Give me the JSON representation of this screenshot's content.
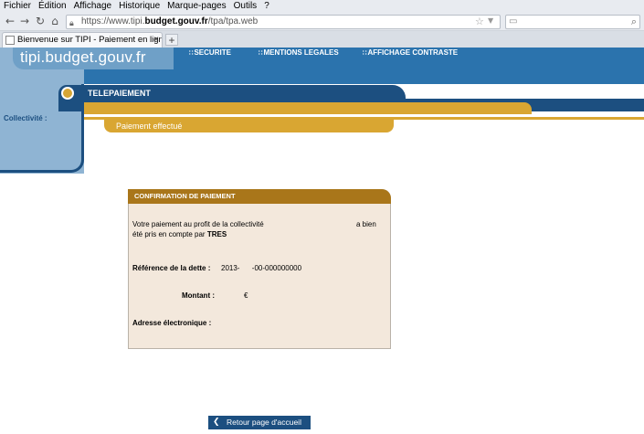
{
  "browser": {
    "menu": [
      "Fichier",
      "Édition",
      "Affichage",
      "Historique",
      "Marque-pages",
      "Outils",
      "?"
    ],
    "url_prefix": "https://www.tipi.",
    "url_domain": "budget.gouv.fr",
    "url_path": "/tpa/tpa.web",
    "tab_title": "Bienvenue sur TIPI - Paiement en ligne d...",
    "tab_close": "×",
    "new_tab": "+"
  },
  "site": {
    "logo": "tipi.budget.gouv.fr",
    "links": [
      "SECURITE",
      "MENTIONS LEGALES",
      "AFFICHAGE CONTRASTE"
    ],
    "collectivite_label": "Collectivité :",
    "section_title": "TELEPAIEMENT",
    "status_tab": "Paiement effectué"
  },
  "confirmation": {
    "title": "CONFIRMATION DE PAIEMENT",
    "line1": "Votre paiement au profit de la collectivité",
    "line1_end": "a bien",
    "line2_start": "été pris en compte par",
    "line2_bold": "TRES",
    "reference_label": "Référence de la dette :",
    "reference_value": "2013-      -00-000000000",
    "montant_label": "Montant :",
    "montant_currency": "€",
    "email_label": "Adresse électronique :"
  },
  "footer": {
    "retour_label": "Retour page d'accueil"
  },
  "colors": {
    "header_blue": "#2b73ad",
    "dark_blue": "#1c4f80",
    "light_blue": "#8fb4d3",
    "gold": "#d9a632",
    "card_header": "#a9761a",
    "card_bg": "#f3e8dc"
  }
}
